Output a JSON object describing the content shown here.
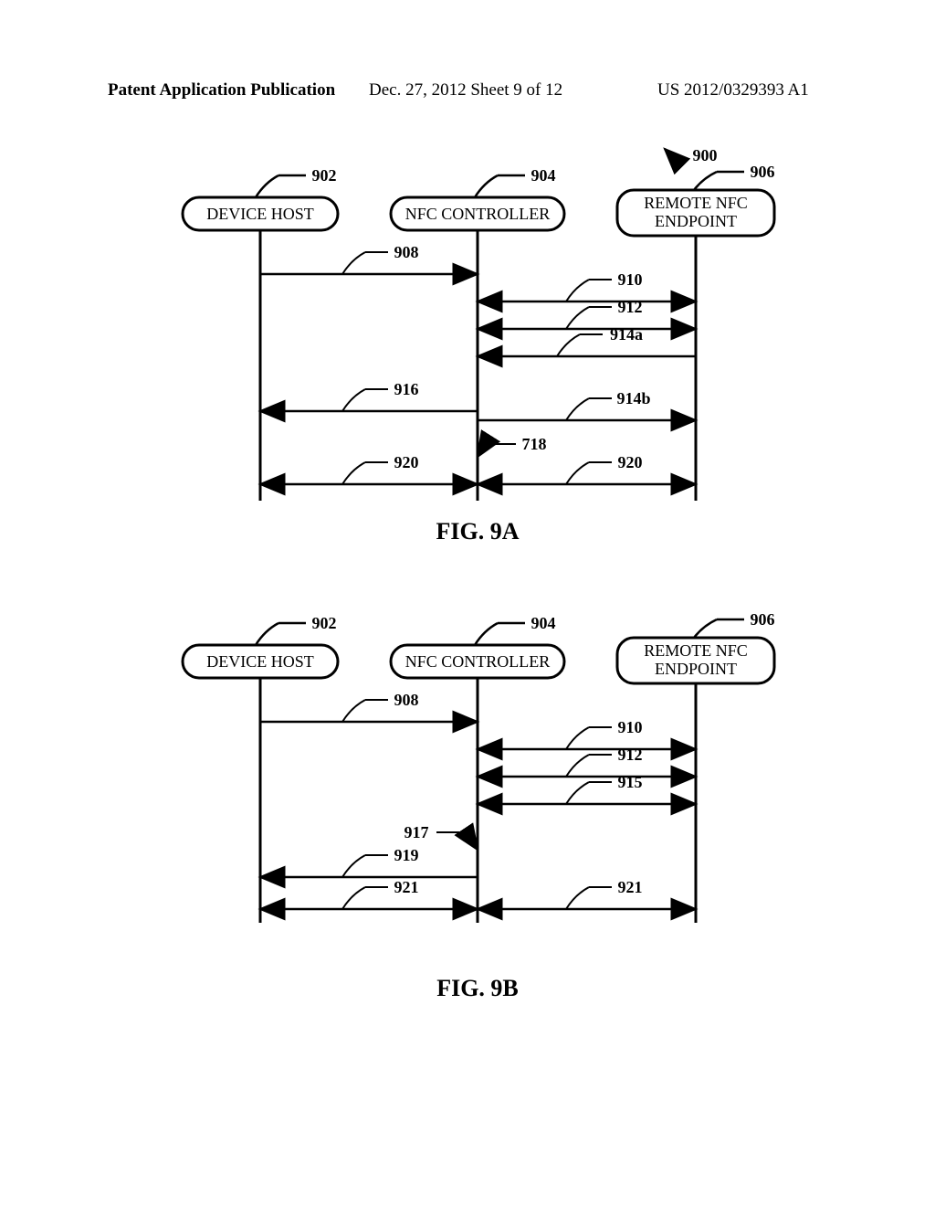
{
  "header": {
    "left": "Patent Application Publication",
    "mid": "Dec. 27, 2012  Sheet 9 of 12",
    "right": "US 2012/0329393 A1"
  },
  "actors": {
    "device_host": "DEVICE HOST",
    "nfc_controller": "NFC CONTROLLER",
    "remote_nfc": "REMOTE NFC",
    "remote_endpoint": "ENDPOINT"
  },
  "refs": {
    "r900": "900",
    "r902": "902",
    "r904": "904",
    "r906": "906",
    "r908": "908",
    "r910": "910",
    "r912": "912",
    "r914a": "914a",
    "r914b": "914b",
    "r915": "915",
    "r916": "916",
    "r917": "917",
    "r718": "718",
    "r919": "919",
    "r920": "920",
    "r921": "921"
  },
  "captions": {
    "fig9a": "FIG. 9A",
    "fig9b": "FIG. 9B"
  }
}
